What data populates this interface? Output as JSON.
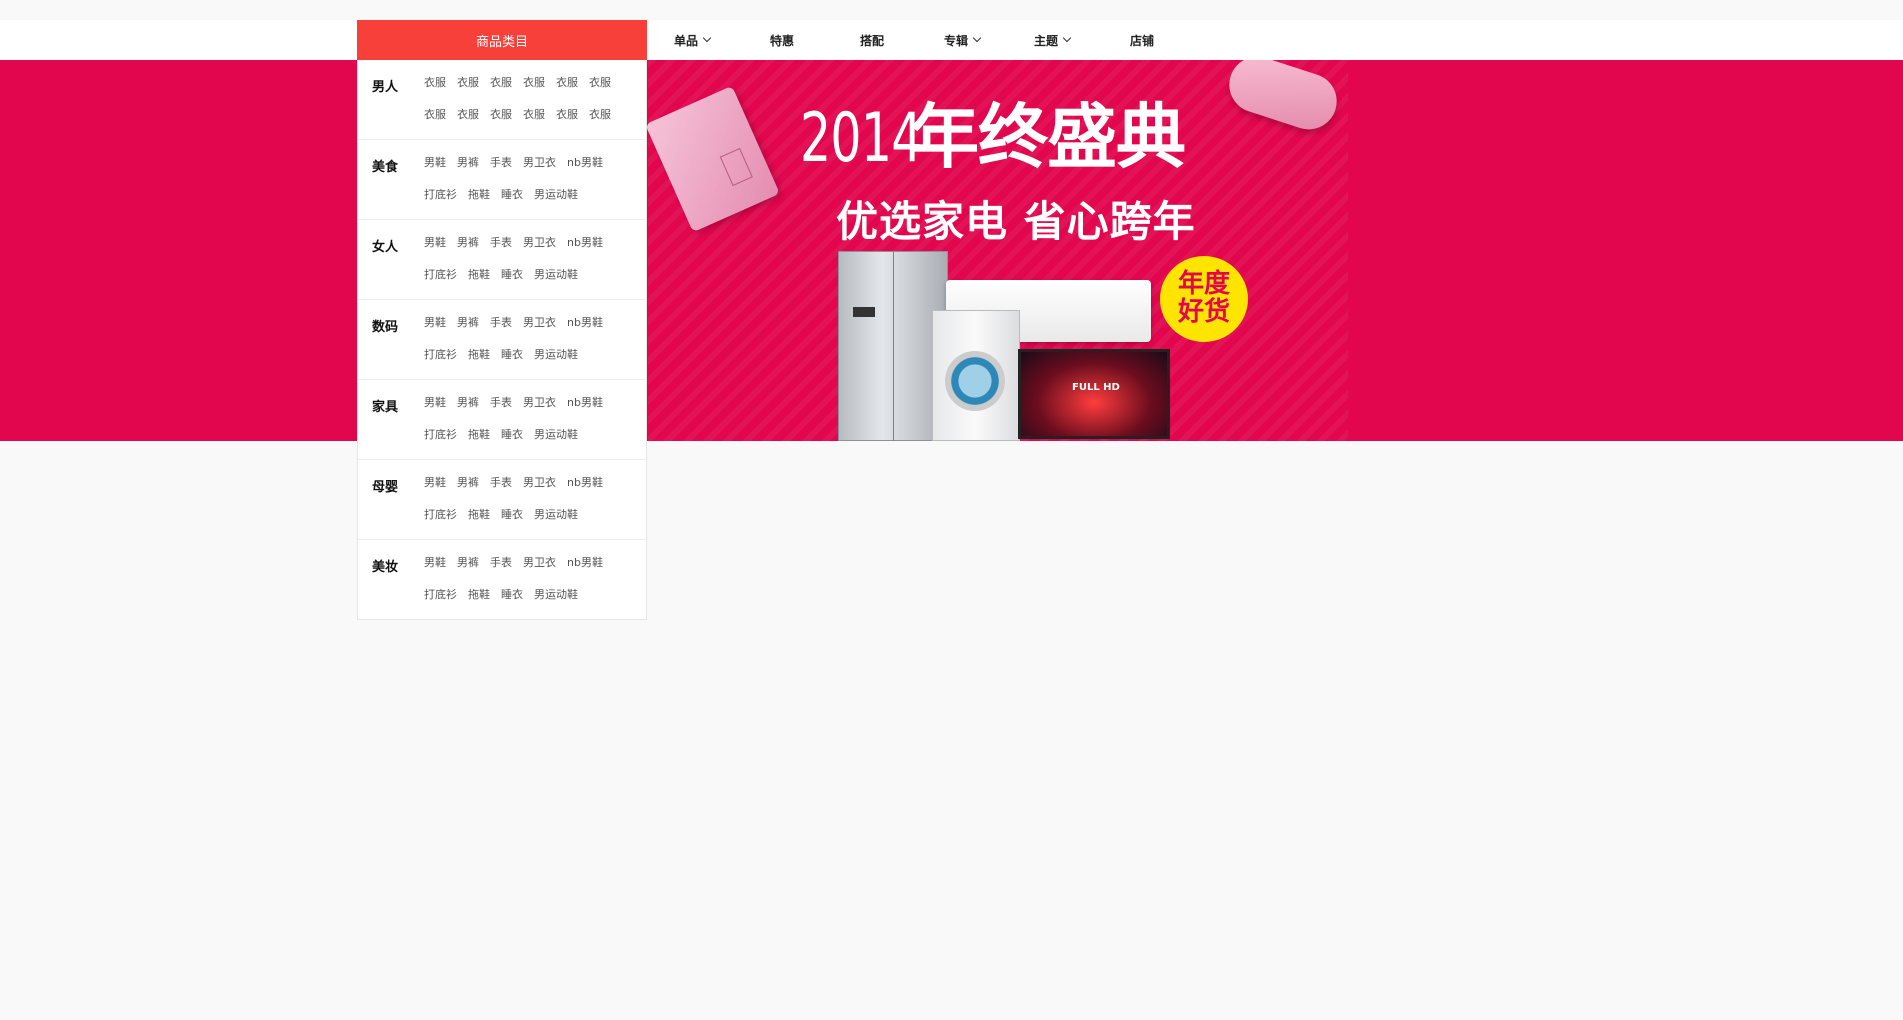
{
  "nav": {
    "category_header": "商品类目",
    "items": [
      {
        "label": "单品",
        "has_dropdown": true
      },
      {
        "label": "特惠",
        "has_dropdown": false
      },
      {
        "label": "搭配",
        "has_dropdown": false
      },
      {
        "label": "专辑",
        "has_dropdown": true
      },
      {
        "label": "主题",
        "has_dropdown": true
      },
      {
        "label": "店铺",
        "has_dropdown": false
      }
    ]
  },
  "categories": [
    {
      "title": "男人",
      "links": [
        "衣服",
        "衣服",
        "衣服",
        "衣服",
        "衣服",
        "衣服",
        "衣服",
        "衣服",
        "衣服",
        "衣服",
        "衣服",
        "衣服"
      ]
    },
    {
      "title": "美食",
      "links": [
        "男鞋",
        "男裤",
        "手表",
        "男卫衣",
        "nb男鞋",
        "打底衫",
        "拖鞋",
        "睡衣",
        "男运动鞋"
      ]
    },
    {
      "title": "女人",
      "links": [
        "男鞋",
        "男裤",
        "手表",
        "男卫衣",
        "nb男鞋",
        "打底衫",
        "拖鞋",
        "睡衣",
        "男运动鞋"
      ]
    },
    {
      "title": "数码",
      "links": [
        "男鞋",
        "男裤",
        "手表",
        "男卫衣",
        "nb男鞋",
        "打底衫",
        "拖鞋",
        "睡衣",
        "男运动鞋"
      ]
    },
    {
      "title": "家具",
      "links": [
        "男鞋",
        "男裤",
        "手表",
        "男卫衣",
        "nb男鞋",
        "打底衫",
        "拖鞋",
        "睡衣",
        "男运动鞋"
      ]
    },
    {
      "title": "母婴",
      "links": [
        "男鞋",
        "男裤",
        "手表",
        "男卫衣",
        "nb男鞋",
        "打底衫",
        "拖鞋",
        "睡衣",
        "男运动鞋"
      ]
    },
    {
      "title": "美妆",
      "links": [
        "男鞋",
        "男裤",
        "手表",
        "男卫衣",
        "nb男鞋",
        "打底衫",
        "拖鞋",
        "睡衣",
        "男运动鞋"
      ]
    }
  ],
  "banner": {
    "year": "2014",
    "headline": "年终盛典",
    "subline": "优选家电  省心跨年",
    "badge_line1": "年度",
    "badge_line2": "好货",
    "tv_text": "FULL HD",
    "bg_color": "#e2064e"
  },
  "colors": {
    "accent": "#f8403a",
    "banner": "#e2064e",
    "badge": "#ffe400",
    "page_bg": "#f9f9f9"
  }
}
